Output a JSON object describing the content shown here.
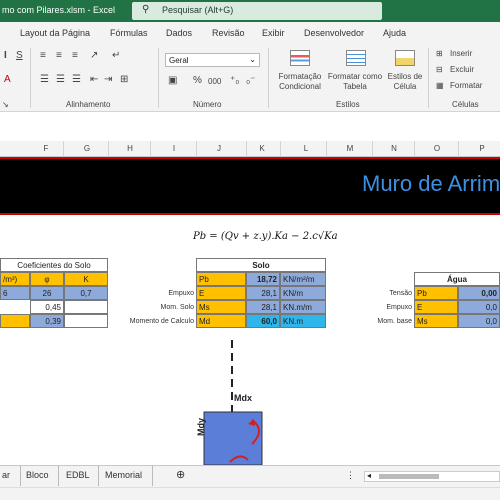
{
  "app": {
    "title": "mo com  Pilares.xlsm  -  Excel",
    "search_placeholder": "Pesquisar (Alt+G)"
  },
  "ribbon_tabs": [
    "Layout da Página",
    "Fórmulas",
    "Dados",
    "Revisão",
    "Exibir",
    "Desenvolvedor",
    "Ajuda"
  ],
  "ribbon": {
    "groups": {
      "alignment": "Alinhamento",
      "number": "Número",
      "styles": "Estilos",
      "cells": "Células"
    },
    "number_format": "Geral",
    "styles_buttons": {
      "cf": "Formatação Condicional",
      "table": "Formatar como Tabela",
      "cellstyles": "Estilos de Célula"
    },
    "cells_buttons": {
      "insert": "Inserir",
      "delete": "Excluir",
      "format": "Formatar"
    },
    "num_symbols": {
      "percent": "%",
      "thousands": "000"
    }
  },
  "columns": [
    "F",
    "G",
    "H",
    "I",
    "J",
    "K",
    "L",
    "M",
    "N",
    "O",
    "P"
  ],
  "banner_title": "Muro de Arrim",
  "formula": "Pb = (Qv + z.y).Ka − 2.c√Ka",
  "coef": {
    "title": "Coeficientes  do Solo",
    "header": [
      "/m³)",
      "φ",
      "K"
    ],
    "row1": [
      "6",
      "26",
      "0,7"
    ],
    "row2": "0,45",
    "row3": "0,39"
  },
  "solo": {
    "title": "Solo",
    "rows": [
      {
        "label": "",
        "code": "Pb",
        "value": "18,72",
        "unit": "KN/m²/m"
      },
      {
        "label": "Empuxo",
        "code": "E",
        "value": "28,1",
        "unit": "KN/m"
      },
      {
        "label": "Mom. Solo",
        "code": "Ms",
        "value": "28,1",
        "unit": "KN.m/m"
      },
      {
        "label": "Momento de Calculo",
        "code": "Md",
        "value": "60,0",
        "unit": "KN.m"
      }
    ]
  },
  "agua": {
    "title": "Água",
    "rows": [
      {
        "label": "Tensão",
        "code": "Pb",
        "value": "0,00"
      },
      {
        "label": "Empuxo",
        "code": "E",
        "value": "0,0"
      },
      {
        "label": "Mom. base",
        "code": "Ms",
        "value": "0,0"
      }
    ]
  },
  "diagram": {
    "mdx": "Mdx",
    "mdy": "Mdy"
  },
  "sheets": [
    "ar",
    "Bloco",
    "EDBL",
    "Memorial"
  ],
  "colors": {
    "excel_green": "#217346",
    "banner_title": "#3d8fe0",
    "yellow": "#ffc000",
    "blue": "#8eaadb",
    "cyan": "#2fb5ea"
  }
}
